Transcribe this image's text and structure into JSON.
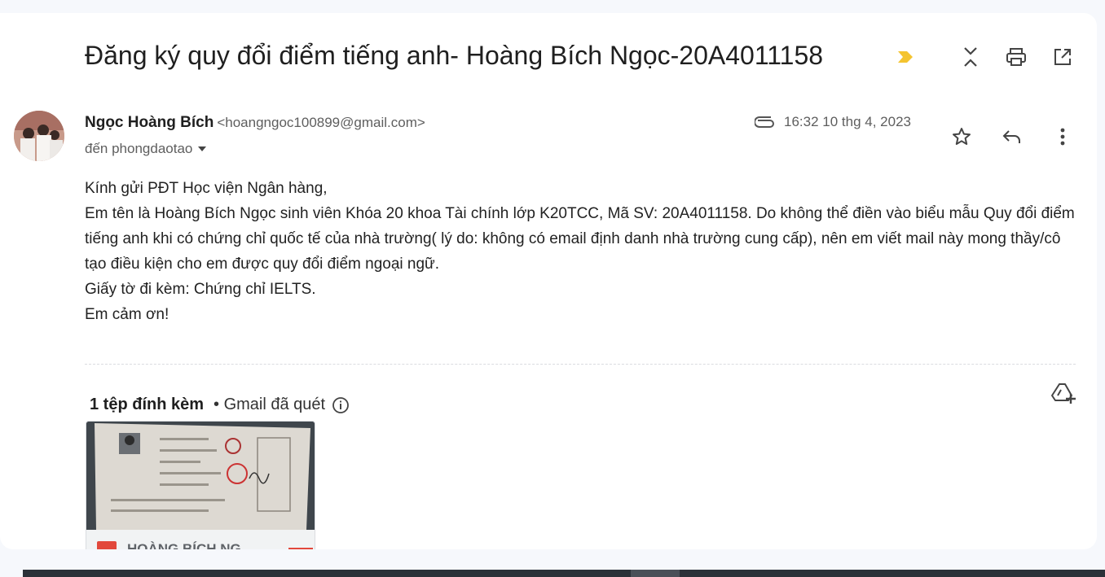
{
  "email": {
    "subject": "Đăng ký quy đổi điểm tiếng anh- Hoàng Bích Ngọc-20A4011158",
    "sender_name": "Ngọc Hoàng Bích",
    "sender_email": "<hoangngoc100899@gmail.com>",
    "recipient_line": "đến phongdaotao",
    "date": "16:32 10 thg 4, 2023",
    "body": [
      "Kính gửi PĐT Học viện Ngân hàng,",
      "Em tên là Hoàng Bích Ngọc sinh viên Khóa 20 khoa Tài chính lớp K20TCC, Mã SV: 20A4011158. Do không thể điền vào biểu mẫu Quy đổi điểm tiếng anh khi có chứng chỉ quốc tế của nhà trường( lý do: không có email định danh nhà trường cung cấp), nên em viết mail này mong thầy/cô tạo điều kiện cho em được quy đổi điểm ngoại ngữ.",
      "Giấy tờ đi kèm: Chứng chỉ IELTS.",
      "Em cảm ơn!"
    ]
  },
  "attachments": {
    "count_label": "1 tệp đính kèm",
    "scan_label": "• Gmail đã quét",
    "file_name": "HOÀNG BÍCH NG"
  },
  "icons": {
    "importance": "importance-marker-icon",
    "collapse": "collapse-all-icon",
    "print": "print-icon",
    "open_new": "open-in-new-window-icon",
    "attachment": "paperclip-icon",
    "star": "star-icon",
    "reply": "reply-icon",
    "more": "more-vert-icon",
    "info": "info-icon",
    "drive": "add-to-drive-icon",
    "pdf": "pdf-icon"
  },
  "colors": {
    "importance": "#f4c430",
    "pdf": "#e2483b"
  }
}
